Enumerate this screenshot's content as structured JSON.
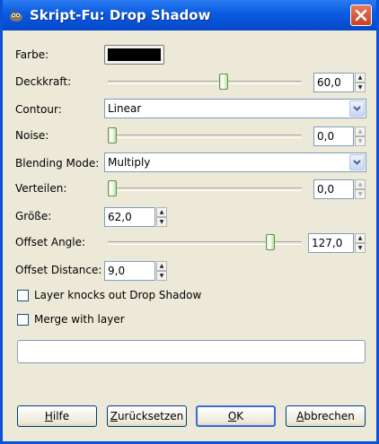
{
  "window": {
    "title": "Skript-Fu: Drop Shadow"
  },
  "colors": {
    "titlebar": "#0a5ae0",
    "window_bg": "#ece9d8",
    "shadow_color": "#000000",
    "close_button": "#c9401f"
  },
  "fields": {
    "farbe": {
      "label": "Farbe:"
    },
    "deckkraft": {
      "label": "Deckkraft:",
      "value": "60,0",
      "slider_fraction": 0.6
    },
    "contour": {
      "label": "Contour:",
      "value": "Linear"
    },
    "noise": {
      "label": "Noise:",
      "value": "0,0",
      "slider_fraction": 0.0
    },
    "blending_mode": {
      "label": "Blending Mode:",
      "value": "Multiply"
    },
    "verteilen": {
      "label": "Verteilen:",
      "value": "0,0",
      "slider_fraction": 0.0
    },
    "groesse": {
      "label": "Größe:",
      "value": "62,0"
    },
    "offset_angle": {
      "label": "Offset Angle:",
      "value": "127,0",
      "slider_fraction": 0.853
    },
    "offset_distance": {
      "label": "Offset Distance:",
      "value": "9,0"
    }
  },
  "checkboxes": {
    "layer_knocks_out": {
      "label": "Layer knocks out Drop Shadow",
      "checked": false
    },
    "merge_with_layer": {
      "label": "Merge with layer",
      "checked": false
    }
  },
  "buttons": {
    "hilfe": {
      "m": "H",
      "rest": "ilfe"
    },
    "zuruecksetzen": {
      "m": "Z",
      "rest": "urücksetzen"
    },
    "ok": {
      "m": "O",
      "rest": "K"
    },
    "abbrechen": {
      "m": "A",
      "rest": "bbrechen"
    }
  }
}
